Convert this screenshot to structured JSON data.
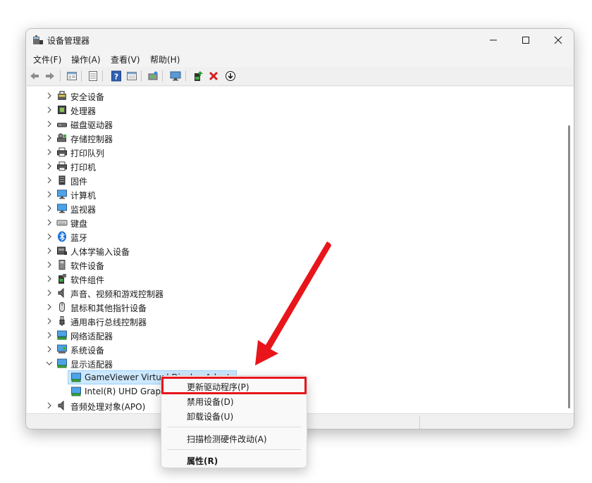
{
  "window": {
    "title": "设备管理器",
    "controls": {
      "minimize": "minimize",
      "maximize": "maximize",
      "close": "close"
    }
  },
  "menubar": [
    {
      "label": "文件(F)"
    },
    {
      "label": "操作(A)"
    },
    {
      "label": "查看(V)"
    },
    {
      "label": "帮助(H)"
    }
  ],
  "toolbar": {
    "icons": [
      "back-arrow-icon",
      "forward-arrow-icon",
      "properties-sheet-icon",
      "list-view-icon",
      "help-icon",
      "show-hidden-icon",
      "scan-hardware-icon",
      "monitor-icon",
      "update-driver-icon",
      "uninstall-x-icon",
      "download-icon"
    ]
  },
  "tree": {
    "items": [
      {
        "label": "安全设备",
        "icon": "security-icon",
        "expanded": false
      },
      {
        "label": "处理器",
        "icon": "cpu-icon",
        "expanded": false
      },
      {
        "label": "磁盘驱动器",
        "icon": "disk-icon",
        "expanded": false
      },
      {
        "label": "存储控制器",
        "icon": "storage-icon",
        "expanded": false
      },
      {
        "label": "打印队列",
        "icon": "printer-icon",
        "expanded": false
      },
      {
        "label": "打印机",
        "icon": "printer-icon",
        "expanded": false
      },
      {
        "label": "固件",
        "icon": "firmware-icon",
        "expanded": false
      },
      {
        "label": "计算机",
        "icon": "computer-icon",
        "expanded": false
      },
      {
        "label": "监视器",
        "icon": "monitor-icon",
        "expanded": false
      },
      {
        "label": "键盘",
        "icon": "keyboard-icon",
        "expanded": false
      },
      {
        "label": "蓝牙",
        "icon": "bluetooth-icon",
        "expanded": false
      },
      {
        "label": "人体学输入设备",
        "icon": "hid-icon",
        "expanded": false
      },
      {
        "label": "软件设备",
        "icon": "software-device-icon",
        "expanded": false
      },
      {
        "label": "软件组件",
        "icon": "software-component-icon",
        "expanded": false
      },
      {
        "label": "声音、视频和游戏控制器",
        "icon": "speaker-icon",
        "expanded": false
      },
      {
        "label": "鼠标和其他指针设备",
        "icon": "mouse-icon",
        "expanded": false
      },
      {
        "label": "通用串行总线控制器",
        "icon": "usb-icon",
        "expanded": false
      },
      {
        "label": "网络适配器",
        "icon": "network-icon",
        "expanded": false
      },
      {
        "label": "系统设备",
        "icon": "system-icon",
        "expanded": false
      },
      {
        "label": "显示适配器",
        "icon": "display-adapter-icon",
        "expanded": true
      },
      {
        "label": "GameViewer Virtual Display Adapter",
        "icon": "display-adapter-icon",
        "child": true,
        "selected": true
      },
      {
        "label": "Intel(R) UHD Graphics",
        "icon": "display-adapter-icon",
        "child": true
      },
      {
        "label": "音频处理对象(APO)",
        "icon": "speaker-icon",
        "expanded": false
      }
    ]
  },
  "context_menu": {
    "items": [
      {
        "label": "更新驱动程序(P)",
        "highlighted": true
      },
      {
        "label": "禁用设备(D)"
      },
      {
        "label": "卸载设备(U)"
      },
      {
        "label": "扫描检测硬件改动(A)"
      },
      {
        "label": "属性(R)",
        "bold": true
      }
    ]
  },
  "colors": {
    "highlight": "#e8151b",
    "selection": "#cce8ff",
    "arrow": "#e8151b"
  }
}
